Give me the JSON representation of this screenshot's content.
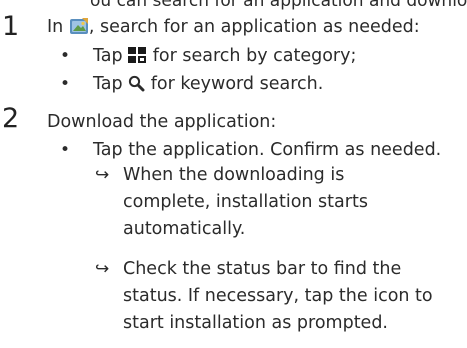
{
  "cut_line": "ou can search for an application and download",
  "steps": [
    {
      "number": "1",
      "text_before": "In ",
      "text_after": ", search for an application as needed:",
      "bullets": [
        {
          "before": "Tap ",
          "after": " for search by category;"
        },
        {
          "before": "Tap ",
          "after": " for keyword search."
        }
      ]
    },
    {
      "number": "2",
      "text": "Download the application:",
      "bullets": [
        {
          "text": "Tap the application. Confirm as needed."
        }
      ],
      "results": [
        {
          "lines": [
            "When the downloading is",
            "complete, installation starts",
            "automatically."
          ]
        },
        {
          "lines": [
            "Check the status bar to find the",
            "status. If necessary, tap the icon to",
            "start installation as prompted."
          ]
        }
      ]
    }
  ],
  "icons": {
    "store": "app-store-icon",
    "category": "category-grid-icon",
    "search": "search-icon",
    "result_arrow": "result-arrow-icon",
    "accent": "#6aa0c8",
    "grid_color": "#1a1a1a",
    "search_color": "#2b2b2b"
  }
}
